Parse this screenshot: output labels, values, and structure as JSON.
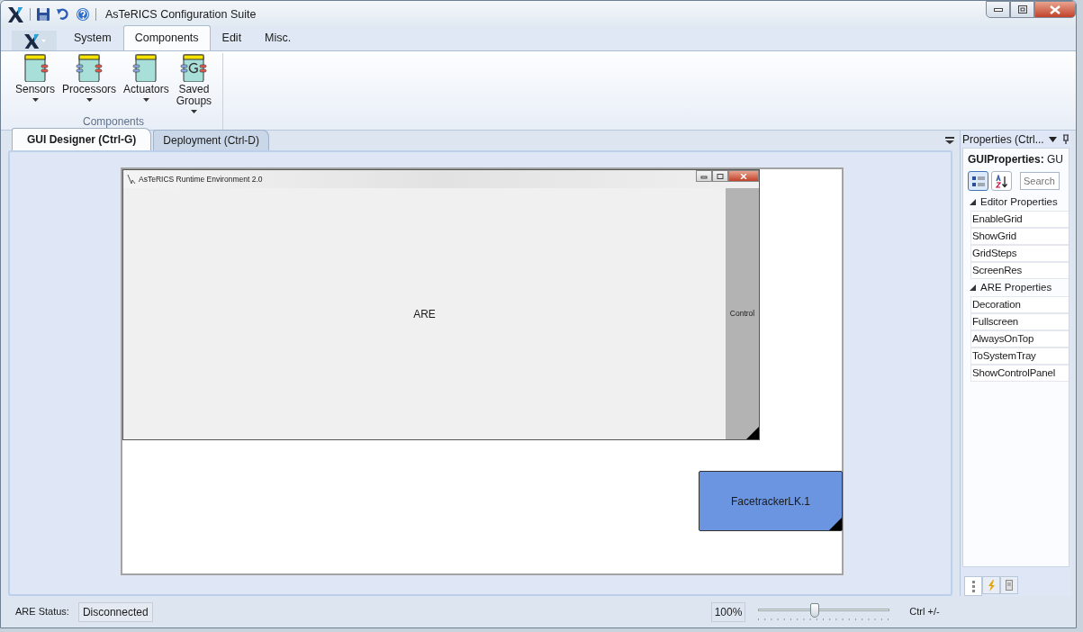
{
  "window": {
    "title": "AsTeRICS Configuration Suite"
  },
  "ribbon": {
    "tabs": [
      {
        "label": "System",
        "selected": false
      },
      {
        "label": "Components",
        "selected": true
      },
      {
        "label": "Edit",
        "selected": false
      },
      {
        "label": "Misc.",
        "selected": false
      }
    ],
    "group": {
      "label": "Components",
      "buttons": [
        {
          "label": "Sensors",
          "kind": "sensor"
        },
        {
          "label": "Processors",
          "kind": "processor"
        },
        {
          "label": "Actuators",
          "kind": "actuator"
        },
        {
          "label": "Saved Groups",
          "kind": "group"
        }
      ]
    }
  },
  "doc_tabs": [
    {
      "label": "GUI Designer (Ctrl-G)",
      "selected": true
    },
    {
      "label": "Deployment (Ctrl-D)",
      "selected": false
    }
  ],
  "canvas": {
    "are_window": {
      "title": "AsTeRICS Runtime Environment 2.0",
      "content": "ARE",
      "control_panel": "Control"
    },
    "components": [
      {
        "label": "FacetrackerLK.1"
      }
    ]
  },
  "properties": {
    "title": "Properties (Ctrl...",
    "object": "**GUIProperties:** GU",
    "sort_modes": [
      {
        "kind": "categorized",
        "selected": true
      },
      {
        "kind": "alphabetical",
        "selected": false
      }
    ],
    "search": {
      "placeholder": "Search"
    },
    "categories": [
      {
        "label": "Editor Properties",
        "expanded": true,
        "children": [
          {
            "label": "EnableGrid"
          },
          {
            "label": "ShowGrid"
          },
          {
            "label": "GridSteps"
          },
          {
            "label": "ScreenRes"
          }
        ]
      },
      {
        "label": "ARE Properties",
        "expanded": true,
        "children": [
          {
            "label": "Decoration"
          },
          {
            "label": "Fullscreen"
          },
          {
            "label": "AlwaysOnTop"
          },
          {
            "label": "ToSystemTray"
          },
          {
            "label": "ShowControlPanel"
          }
        ]
      }
    ],
    "panel_tabs": [
      {
        "kind": "list",
        "selected": true
      },
      {
        "kind": "events",
        "selected": false
      },
      {
        "kind": "document",
        "selected": false
      }
    ]
  },
  "status_bar": {
    "label": "ARE Status:",
    "value": "Disconnected",
    "zoom": "100%",
    "zoom_slider": {
      "level": 0.43
    },
    "hint": "Ctrl +/-"
  }
}
